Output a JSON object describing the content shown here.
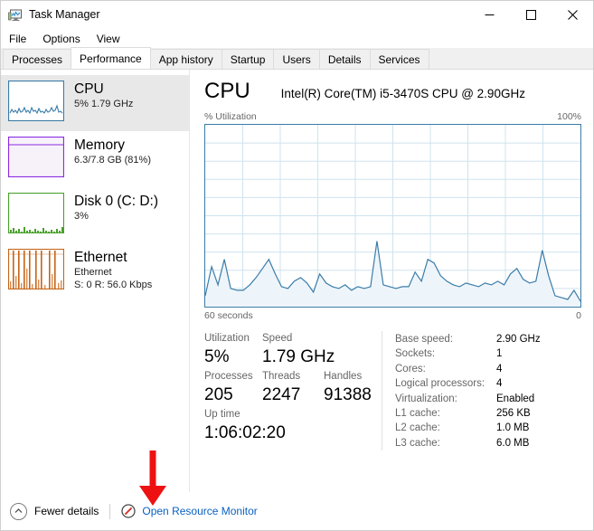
{
  "window": {
    "title": "Task Manager",
    "icon": "task-manager-icon",
    "controls": [
      {
        "name": "minimize",
        "glyph": "—"
      },
      {
        "name": "maximize",
        "glyph": "□"
      },
      {
        "name": "close",
        "glyph": "✕"
      }
    ]
  },
  "menu": {
    "items": [
      "File",
      "Options",
      "View"
    ]
  },
  "tabs": {
    "items": [
      {
        "label": "Processes",
        "active": false
      },
      {
        "label": "Performance",
        "active": true
      },
      {
        "label": "App history",
        "active": false
      },
      {
        "label": "Startup",
        "active": false
      },
      {
        "label": "Users",
        "active": false
      },
      {
        "label": "Details",
        "active": false
      },
      {
        "label": "Services",
        "active": false
      }
    ]
  },
  "sidebar": {
    "items": [
      {
        "name": "cpu",
        "title": "CPU",
        "sub1": "5%  1.79 GHz",
        "sub2": "",
        "selected": true,
        "color": "#3a7ca8",
        "thumb": "cpu-mini-graph"
      },
      {
        "name": "memory",
        "title": "Memory",
        "sub1": "6.3/7.8 GB (81%)",
        "sub2": "",
        "selected": false,
        "color": "#8a2be2",
        "thumb": "memory-mini-graph"
      },
      {
        "name": "disk",
        "title": "Disk 0 (C: D:)",
        "sub1": "3%",
        "sub2": "",
        "selected": false,
        "color": "#4aa02c",
        "thumb": "disk-mini-graph"
      },
      {
        "name": "ethernet",
        "title": "Ethernet",
        "sub1": "Ethernet",
        "sub2": "S: 0 R: 56.0 Kbps",
        "selected": false,
        "color": "#c4651a",
        "thumb": "ethernet-mini-graph"
      }
    ]
  },
  "main": {
    "title": "CPU",
    "model": "Intel(R) Core(TM) i5-3470S CPU @ 2.90GHz",
    "graph": {
      "y_label": "% Utilization",
      "y_max_label": "100%",
      "x_left_label": "60 seconds",
      "x_right_label": "0",
      "line_color": "#3a7ca8",
      "fill_color": "#eef5fa",
      "grid_color": "#cfe3ef"
    },
    "stats": {
      "utilization": {
        "label": "Utilization",
        "value": "5%"
      },
      "speed": {
        "label": "Speed",
        "value": "1.79 GHz"
      },
      "processes": {
        "label": "Processes",
        "value": "205"
      },
      "threads": {
        "label": "Threads",
        "value": "2247"
      },
      "handles": {
        "label": "Handles",
        "value": "91388"
      },
      "uptime": {
        "label": "Up time",
        "value": "1:06:02:20"
      }
    },
    "specs": [
      {
        "key": "Base speed:",
        "value": "2.90 GHz"
      },
      {
        "key": "Sockets:",
        "value": "1"
      },
      {
        "key": "Cores:",
        "value": "4"
      },
      {
        "key": "Logical processors:",
        "value": "4"
      },
      {
        "key": "Virtualization:",
        "value": "Enabled"
      },
      {
        "key": "L1 cache:",
        "value": "256 KB"
      },
      {
        "key": "L2 cache:",
        "value": "1.0 MB"
      },
      {
        "key": "L3 cache:",
        "value": "6.0 MB"
      }
    ]
  },
  "footer": {
    "fewer_details": "Fewer details",
    "resource_monitor": "Open Resource Monitor",
    "link_color": "#0a60c2"
  },
  "annotation": {
    "arrow_color": "#ee1111",
    "points_at": "Open Resource Monitor"
  },
  "chart_data": {
    "type": "line",
    "title": "CPU % Utilization",
    "xlabel": "60 seconds",
    "ylabel": "% Utilization",
    "ylim": [
      0,
      100
    ],
    "xlim": [
      60,
      0
    ],
    "grid": true,
    "legend": false,
    "series": [
      {
        "name": "CPU utilization",
        "values": [
          6,
          22,
          12,
          26,
          10,
          9,
          9,
          12,
          16,
          21,
          26,
          18,
          11,
          10,
          14,
          16,
          13,
          8,
          18,
          13,
          11,
          10,
          12,
          9,
          11,
          10,
          11,
          36,
          12,
          11,
          10,
          11,
          11,
          19,
          14,
          26,
          24,
          17,
          14,
          12,
          11,
          13,
          12,
          11,
          13,
          12,
          14,
          12,
          18,
          21,
          15,
          13,
          14,
          31,
          17,
          6,
          5,
          4,
          9,
          3
        ]
      }
    ]
  }
}
